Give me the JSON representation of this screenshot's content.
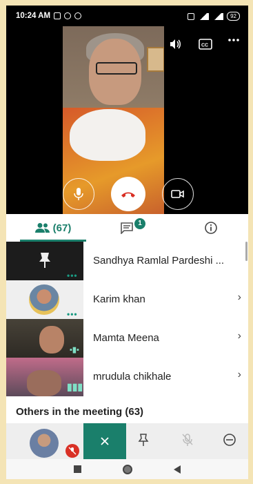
{
  "status_bar": {
    "time": "10:24 AM",
    "battery": "92"
  },
  "tabs": [
    {
      "name": "participants",
      "label": "(67)",
      "icon": "people-icon"
    },
    {
      "name": "chat",
      "badge": "1",
      "icon": "chat-icon"
    },
    {
      "name": "info",
      "icon": "info-icon"
    }
  ],
  "participants": [
    {
      "name": "Sandhya Ramlal Pardeshi ...",
      "thumb": "pin-icon"
    },
    {
      "name": "Karim khan"
    },
    {
      "name": "Mamta Meena"
    },
    {
      "name": "mrudula chikhale"
    }
  ],
  "others_heading": "Others in the meeting (63)",
  "colors": {
    "accent": "#1a7f6b",
    "end_call": "#d93025",
    "mic_off": "#d93025"
  }
}
